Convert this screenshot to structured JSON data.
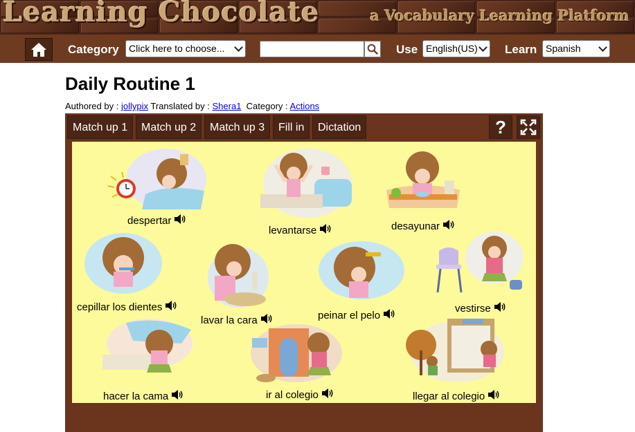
{
  "header": {
    "brand": "Learning Chocolate",
    "tagline": "a Vocabulary Learning Platform"
  },
  "nav": {
    "category_label": "Category",
    "category_value": "Click here to choose...",
    "search_value": "",
    "use_label": "Use",
    "use_value": "English(US)",
    "learn_label": "Learn",
    "learn_value": "Spanish"
  },
  "page": {
    "title": "Daily Routine 1",
    "authored_by_label": "Authored by :",
    "author": "jollypix",
    "translated_by_label": "Translated by :",
    "translator": "Shera1",
    "category_label": "Category :",
    "category": "Actions"
  },
  "tabs": [
    "Match up 1",
    "Match up 2",
    "Match up 3",
    "Fill in",
    "Dictation"
  ],
  "tools": {
    "help": "?"
  },
  "words": [
    "despertar",
    "levantarse",
    "desayunar",
    "cepillar los dientes",
    "lavar la cara",
    "peinar el pelo",
    "vestirse",
    "hacer la cama",
    "ir al colegio",
    "llegar al colegio"
  ],
  "colors": {
    "banner": "#4a2416",
    "navbar": "#6e3a20",
    "panel": "#6a341d",
    "board": "#fdfa9c"
  }
}
